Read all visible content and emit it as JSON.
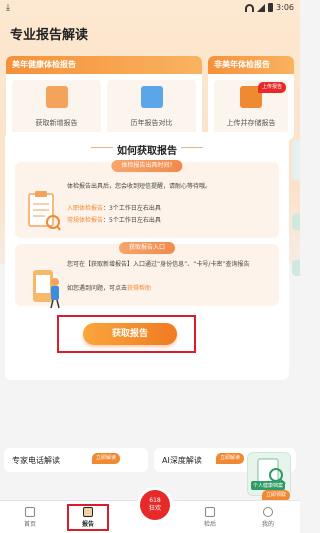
{
  "status_bar": {
    "time": "3:06"
  },
  "page_title": "专业报告解读",
  "meinian_panel": {
    "title": "美年健康体检报告",
    "cards": [
      {
        "label": "获取新增报告"
      },
      {
        "label": "历年报告对比"
      }
    ]
  },
  "other_panel": {
    "title": "非美年体检报告",
    "badge": "上传报告",
    "card_label": "上传并存储报告"
  },
  "howto": {
    "title": "如何获取报告",
    "section1": {
      "pill": "体检报告出具时间?",
      "intro": "体检报告出具后，您会收到短信提醒，请耐心等待哦。",
      "items": [
        {
          "key": "入职体检报告",
          "value": "3个工作日左右出具"
        },
        {
          "key": "常规体检报告",
          "value": "5个工作日左右出具"
        }
      ]
    },
    "section2": {
      "pill": "获取报告入口",
      "text": "您可在【获取新增报告】入口通过“身份信息”、“卡号/卡密”查询报告",
      "help_prefix": "如您遇到问题，可点击",
      "help_link": "获得帮助"
    }
  },
  "main_button": "获取报告",
  "bottom_cards": [
    {
      "label": "专家电话解读",
      "tag": "立即解读"
    },
    {
      "label": "AI深度解读",
      "tag": "立即解读"
    }
  ],
  "float_badge": "个人健康档案",
  "float_tag": "立即领取",
  "tabs": [
    {
      "label": "首页"
    },
    {
      "label": "报告"
    },
    {
      "label": "618\n狂欢"
    },
    {
      "label": "检后"
    },
    {
      "label": "我的"
    }
  ],
  "colors": {
    "accent": "#f08a32",
    "highlight_red": "#d81e2a"
  }
}
